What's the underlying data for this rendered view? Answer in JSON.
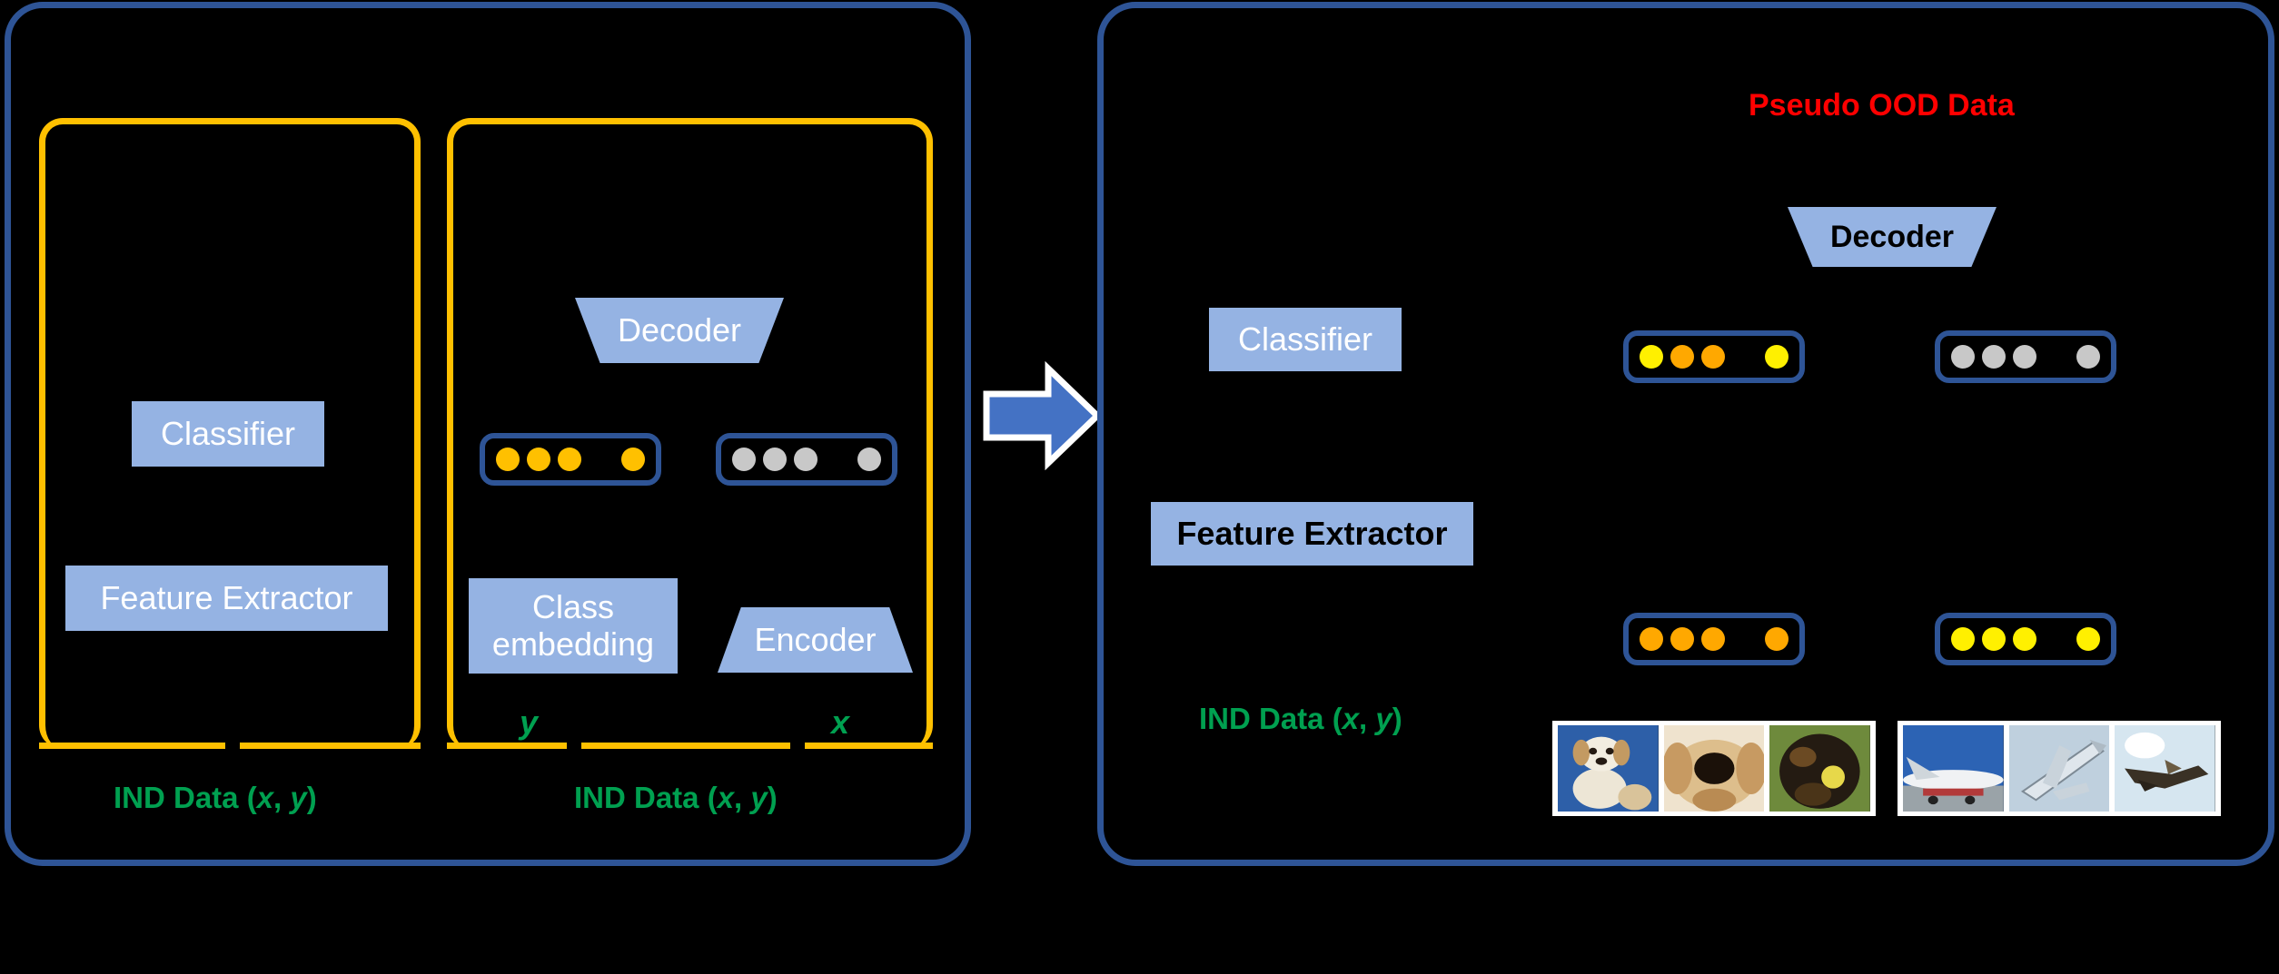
{
  "left_panel": {
    "name": "training-stage-panel",
    "box_a": {
      "classifier_label": "Classifier",
      "feature_extractor_label": "Feature Extractor",
      "caption": "IND Data (x, y)"
    },
    "box_b": {
      "decoder_label": "Decoder",
      "class_embedding_label": "Class\nembedding",
      "encoder_label": "Encoder",
      "y_label": "y",
      "x_label": "x",
      "caption": "IND Data (x, y)",
      "latent_left": {
        "name": "latent-vector-yellow",
        "dots": [
          "#FFC000",
          "#FFC000",
          "#FFC000",
          "#FFC000"
        ]
      },
      "latent_right": {
        "name": "latent-vector-gray",
        "dots": [
          "#C8C8C8",
          "#C8C8C8",
          "#C8C8C8",
          "#C8C8C8"
        ]
      }
    }
  },
  "arrow": {
    "name": "stage-transition-arrow",
    "color": "#4472C4",
    "outline": "#FFFFFF"
  },
  "right_panel": {
    "name": "generation-stage-panel",
    "pseudo_ood_title": "Pseudo OOD Data",
    "classifier_label": "Classifier",
    "feature_extractor_label": "Feature Extractor",
    "decoder_label": "Decoder",
    "ind_caption": "IND Data (x, y)",
    "latents": [
      {
        "name": "latent-top-left",
        "dots": [
          "#FFF000",
          "#FFA800",
          "#FFA800",
          "#FFF000"
        ]
      },
      {
        "name": "latent-top-right",
        "dots": [
          "#C8C8C8",
          "#C8C8C8",
          "#C8C8C8",
          "#C8C8C8"
        ]
      },
      {
        "name": "latent-bottom-left",
        "dots": [
          "#FFA800",
          "#FFA800",
          "#FFA800",
          "#FFA800"
        ]
      },
      {
        "name": "latent-bottom-right",
        "dots": [
          "#FFF000",
          "#FFF000",
          "#FFF000",
          "#FFF000"
        ]
      }
    ],
    "image_strips": [
      {
        "name": "dog-image-strip",
        "caption": "dog photos"
      },
      {
        "name": "airplane-image-strip",
        "caption": "airplane photos"
      }
    ]
  },
  "colors": {
    "panel_border": "#2E5496",
    "inner_border": "#FFC000",
    "block_fill": "#95B3E3",
    "green_text": "#00A050",
    "red_text": "#FF0000",
    "arrow_fill": "#4472C4"
  }
}
